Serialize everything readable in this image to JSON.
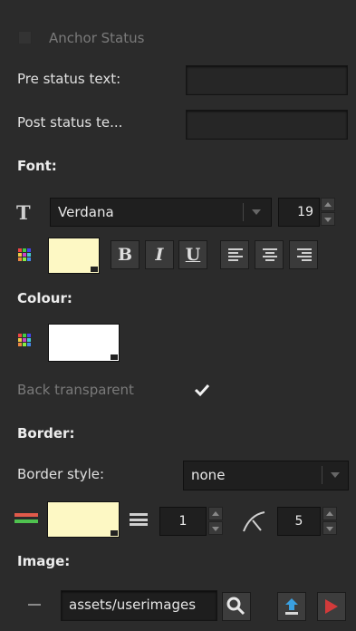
{
  "anchor_status": {
    "label": "Anchor Status",
    "checked": false
  },
  "pre_status": {
    "label": "Pre status text:",
    "value": ""
  },
  "post_status": {
    "label": "Post status te...",
    "value": ""
  },
  "font": {
    "section": "Font:",
    "family": "Verdana",
    "size": "19",
    "bold_label": "B",
    "italic_label": "I",
    "underline_label": "U",
    "font_color": "#fdf8c4"
  },
  "colour": {
    "section": "Colour:",
    "value": "#ffffff"
  },
  "back_transparent": {
    "label": "Back transparent",
    "checked": true
  },
  "border": {
    "section": "Border:",
    "style_label": "Border style:",
    "style_value": "none",
    "color": "#fdf8c4",
    "width": "1",
    "radius": "5"
  },
  "image": {
    "section": "Image:",
    "path": "assets/userimages"
  },
  "icons": {
    "font": "font-T-icon",
    "palette": "color-palette-icon",
    "align_left": "align-left-icon",
    "align_center": "align-center-icon",
    "align_right": "align-right-icon",
    "border_color": "border-color-icon",
    "border_width": "border-width-icon",
    "border_radius": "border-radius-icon",
    "image_remove": "minus-icon",
    "search": "search-icon",
    "upload": "upload-icon",
    "delete": "delete-icon"
  }
}
